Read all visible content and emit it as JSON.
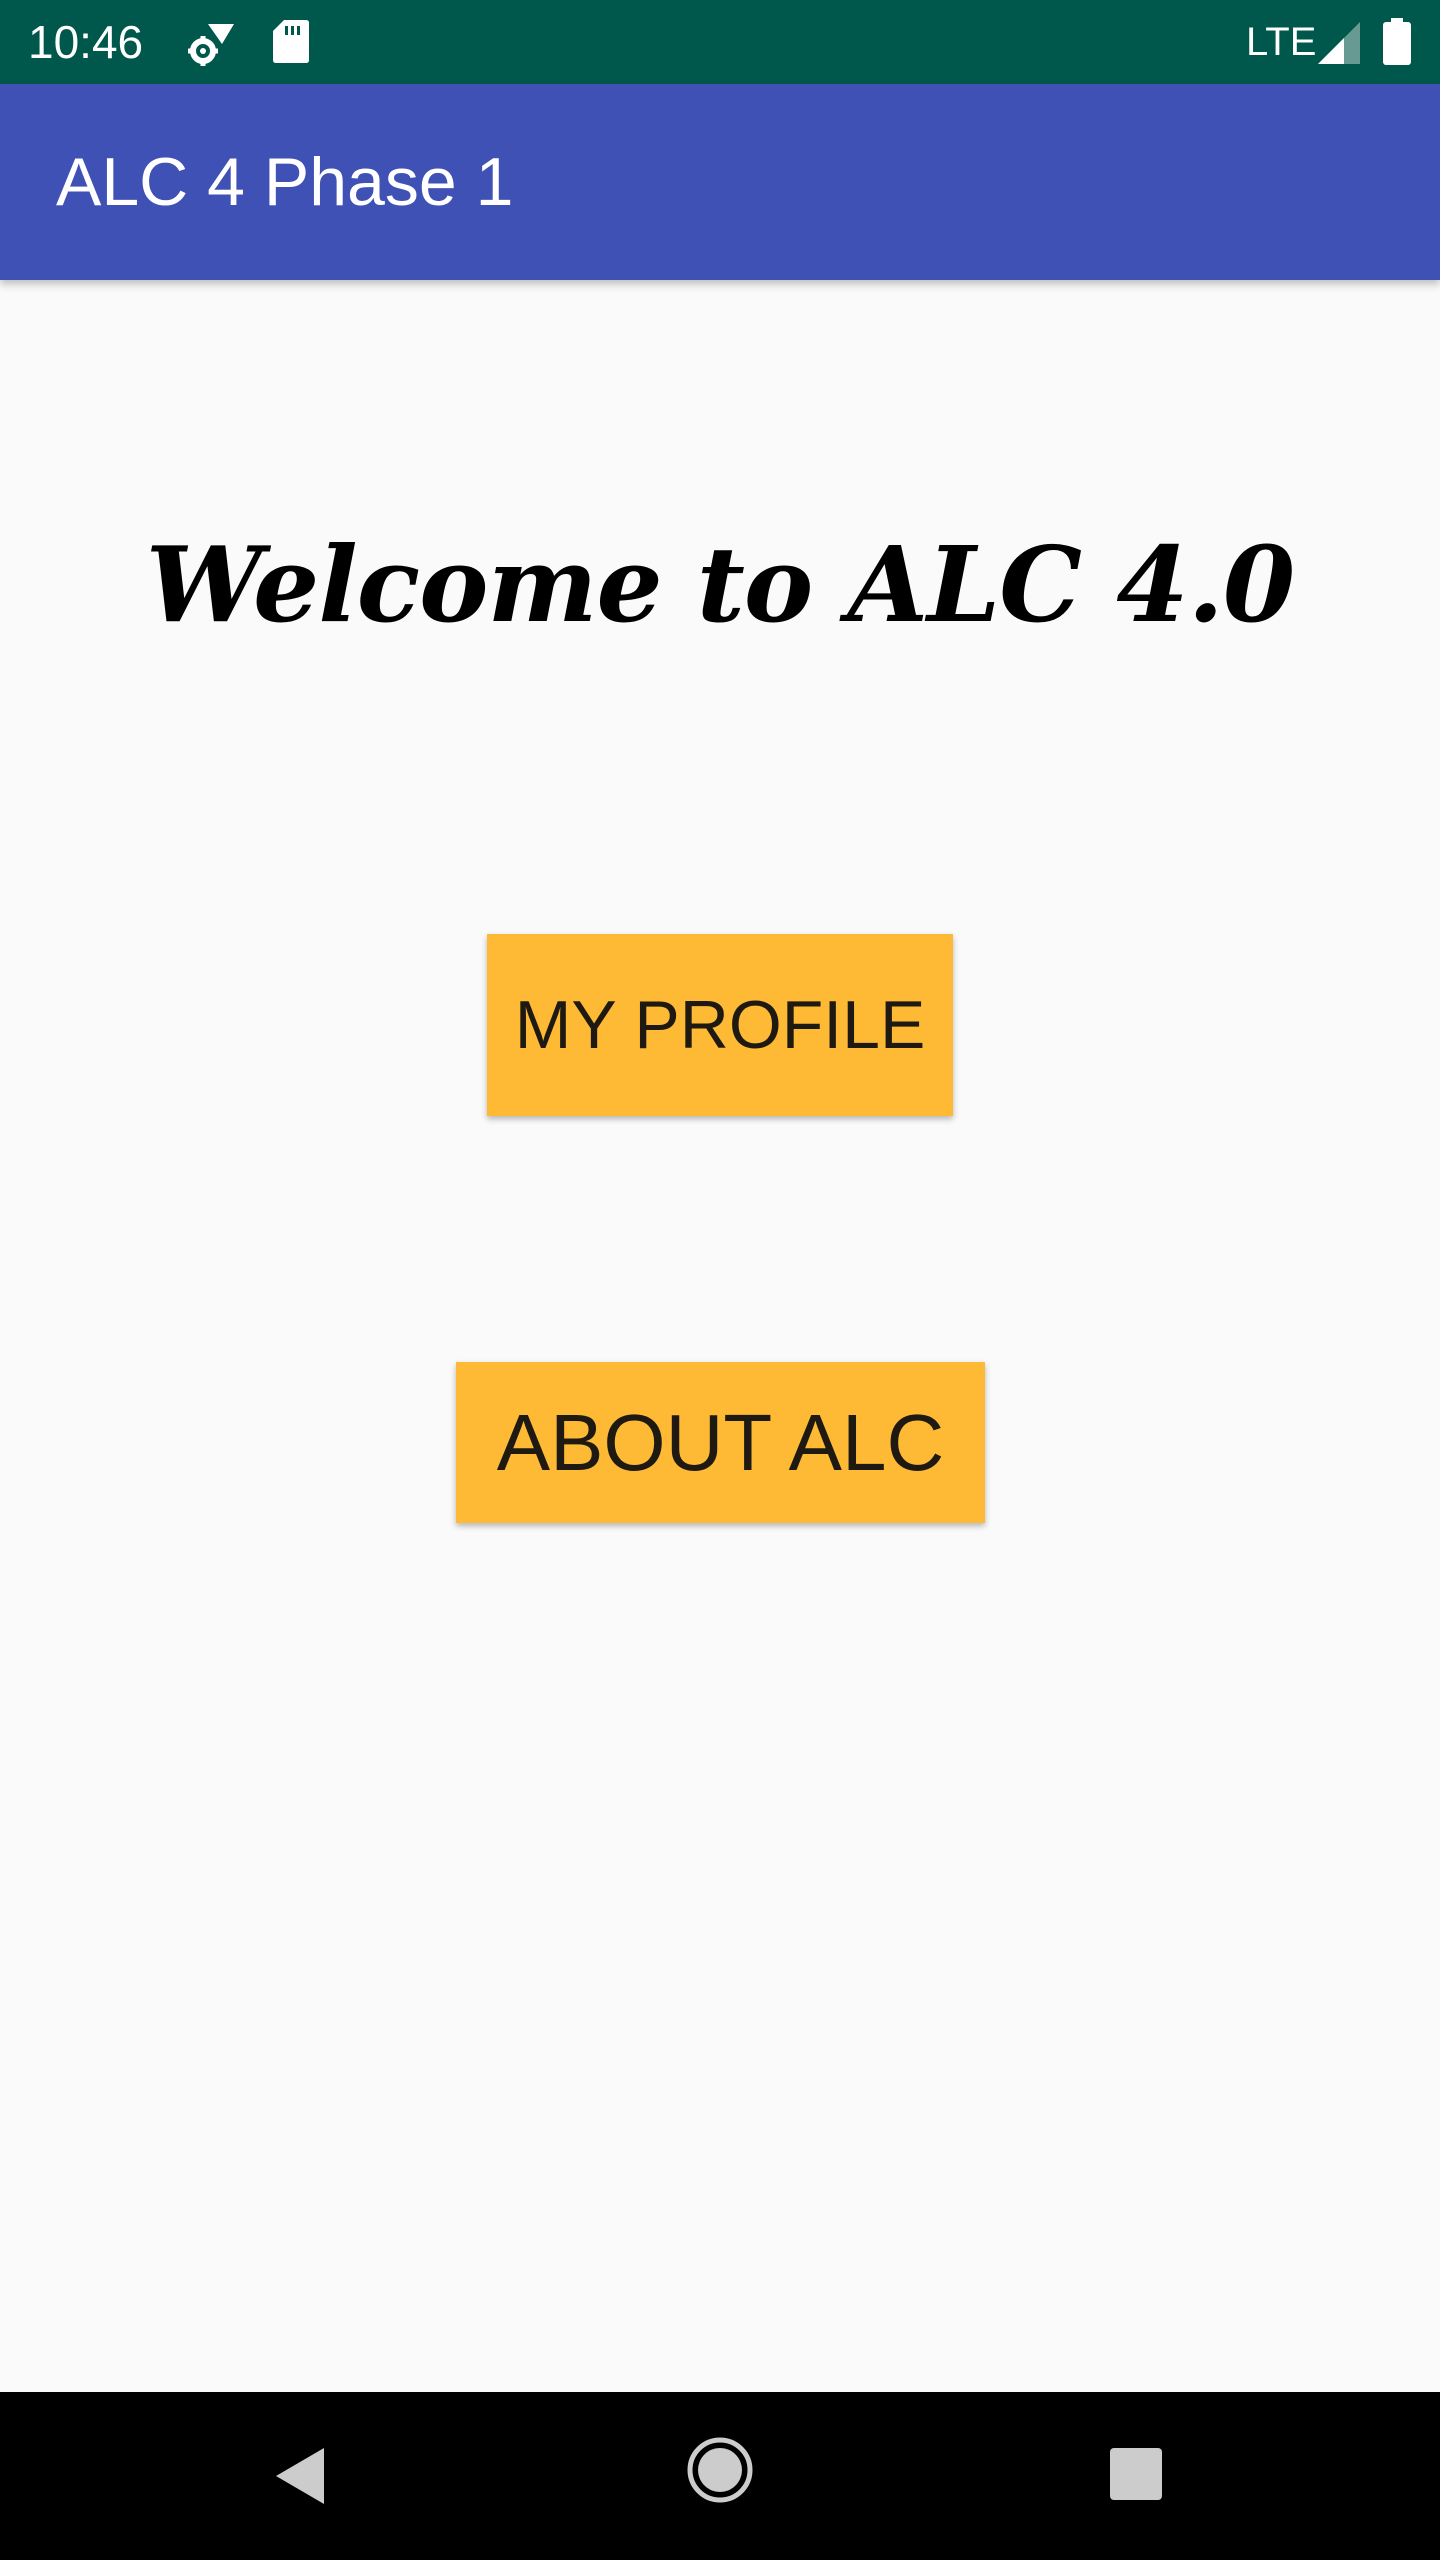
{
  "status_bar": {
    "time": "10:46",
    "network": "LTE",
    "icons": [
      "settings-sync-icon",
      "sd-card-icon",
      "signal-icon",
      "battery-icon"
    ],
    "background_color": "#00574b"
  },
  "app_bar": {
    "title": "ALC 4 Phase 1",
    "background_color": "#3f51b5"
  },
  "main": {
    "heading": "Welcome to ALC 4.0",
    "buttons": {
      "profile_label": "MY PROFILE",
      "about_label": "ABOUT ALC"
    },
    "button_color": "#ffba35"
  },
  "nav_bar": {
    "icons": [
      "back-icon",
      "home-icon",
      "recents-icon"
    ]
  }
}
